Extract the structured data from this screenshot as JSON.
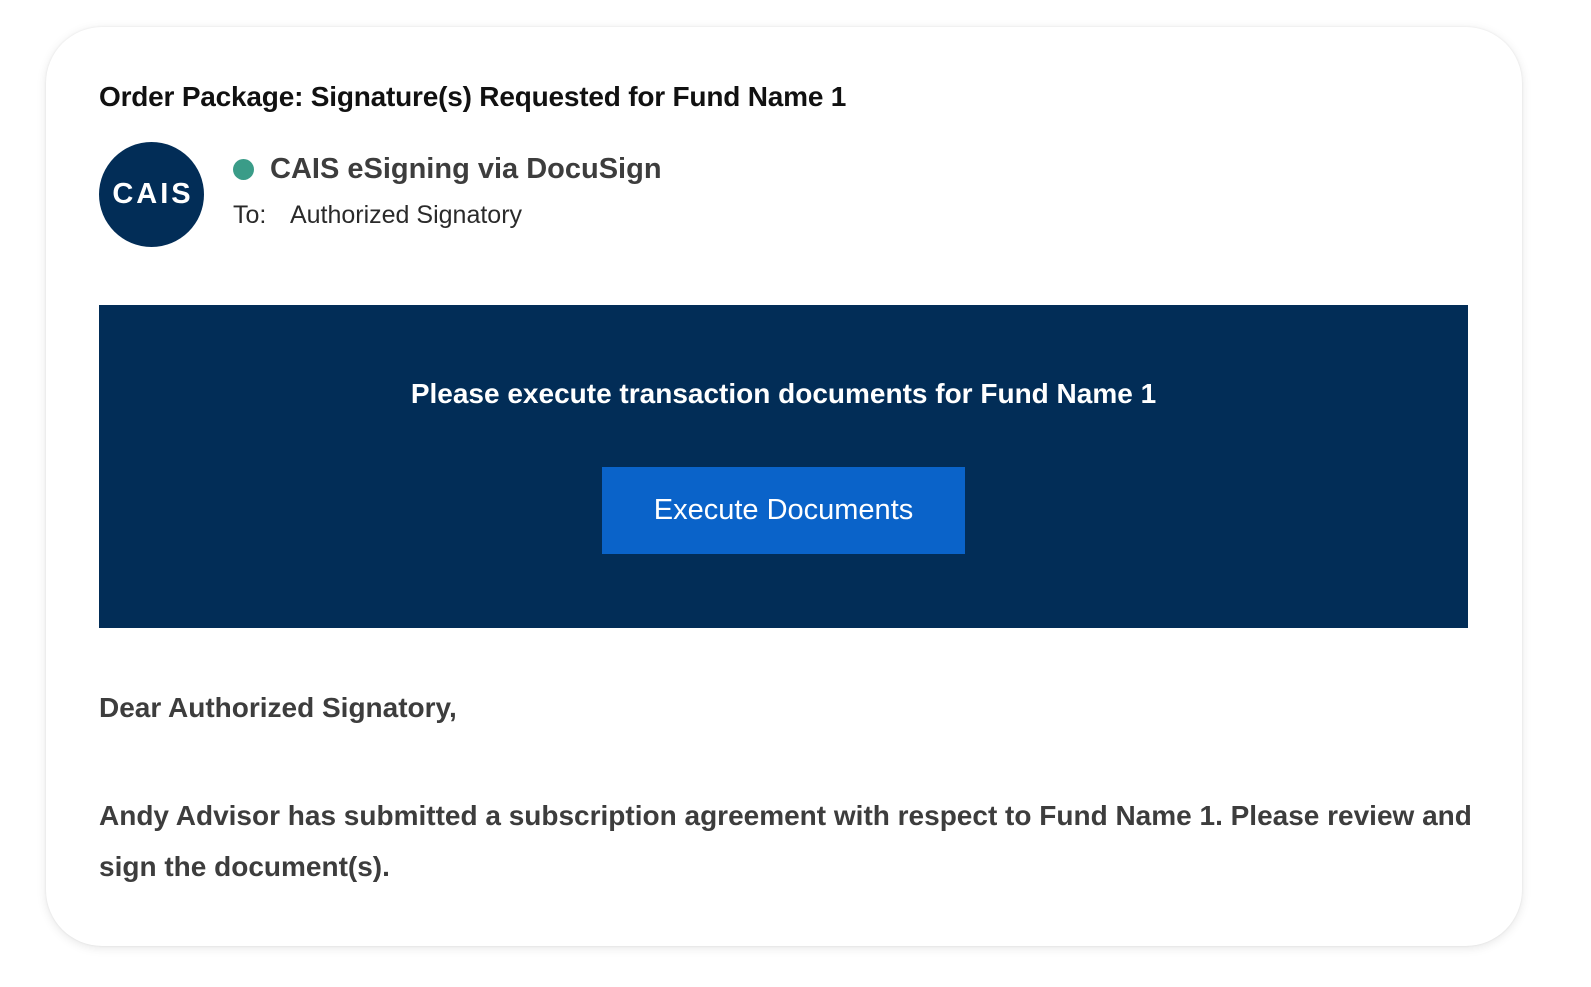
{
  "email": {
    "subject": "Order Package: Signature(s) Requested for Fund Name 1",
    "avatar_text": "CAIS",
    "sender_name": "CAIS eSigning via DocuSign",
    "to_label": "To:",
    "to_value": "Authorized Signatory"
  },
  "banner": {
    "heading": "Please execute transaction documents for Fund Name 1",
    "button_label": "Execute Documents"
  },
  "message": {
    "greeting": "Dear Authorized Signatory,",
    "body": "Andy Advisor has submitted a subscription agreement with respect to Fund Name 1. Please review and sign the document(s)."
  },
  "colors": {
    "navy": "#022d57",
    "button_blue": "#0a63c9",
    "status_green": "#3a9c88"
  }
}
